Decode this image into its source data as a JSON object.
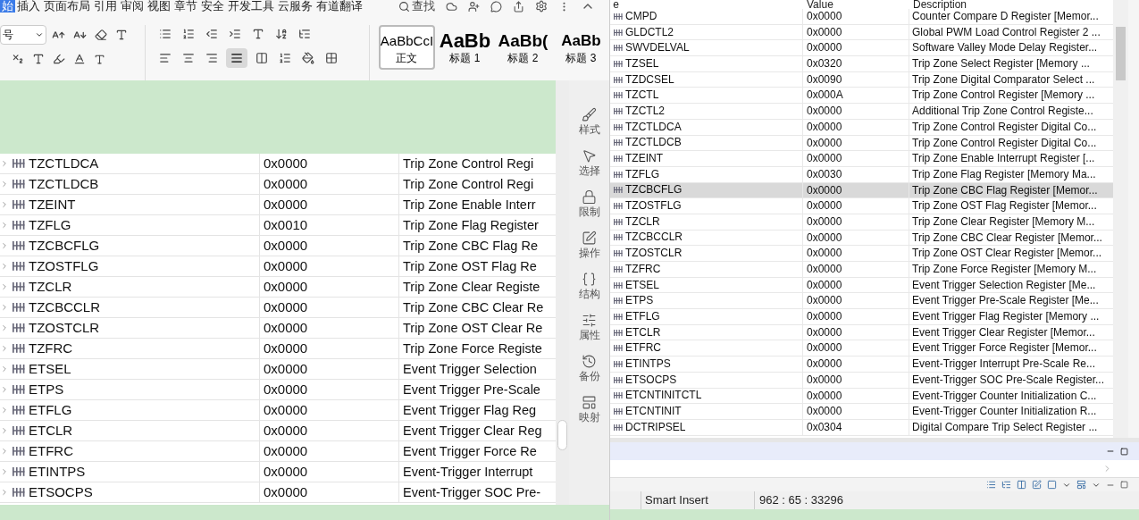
{
  "document_toolbar": {
    "menu_tabs": [
      {
        "label": "始",
        "selected": true
      },
      {
        "label": "插入",
        "selected": false
      },
      {
        "label": "页面布局",
        "selected": false
      },
      {
        "label": "引用",
        "selected": false
      },
      {
        "label": "审阅",
        "selected": false
      },
      {
        "label": "视图",
        "selected": false
      },
      {
        "label": "章节",
        "selected": false
      },
      {
        "label": "安全",
        "selected": false
      },
      {
        "label": "开发工具",
        "selected": false
      },
      {
        "label": "云服务",
        "selected": false
      },
      {
        "label": "有道翻译",
        "selected": false
      }
    ],
    "search": "查找",
    "font_size": "号",
    "styles": [
      {
        "kind": "body",
        "preview": "AaBbCcI",
        "label": "正文",
        "selected": true
      },
      {
        "kind": "heading1",
        "preview": "AaBb",
        "label": "标题 1",
        "selected": false
      },
      {
        "kind": "heading2",
        "preview": "AaBb(",
        "label": "标题 2",
        "selected": false
      },
      {
        "kind": "heading3",
        "preview": "AaBb",
        "label": "标题 3",
        "selected": false
      }
    ]
  },
  "document_table": {
    "rows": [
      {
        "name": "TZCTLDCA",
        "value": "0x0000",
        "description": "Trip Zone Control Regi"
      },
      {
        "name": "TZCTLDCB",
        "value": "0x0000",
        "description": "Trip Zone Control Regi"
      },
      {
        "name": "TZEINT",
        "value": "0x0000",
        "description": "Trip Zone Enable Interr"
      },
      {
        "name": "TZFLG",
        "value": "0x0010",
        "description": "Trip Zone Flag Register"
      },
      {
        "name": "TZCBCFLG",
        "value": "0x0000",
        "description": "Trip Zone CBC Flag Re"
      },
      {
        "name": "TZOSTFLG",
        "value": "0x0000",
        "description": "Trip Zone OST Flag Re"
      },
      {
        "name": "TZCLR",
        "value": "0x0000",
        "description": "Trip Zone Clear Registe"
      },
      {
        "name": "TZCBCCLR",
        "value": "0x0000",
        "description": "Trip Zone CBC Clear Re"
      },
      {
        "name": "TZOSTCLR",
        "value": "0x0000",
        "description": "Trip Zone OST Clear Re"
      },
      {
        "name": "TZFRC",
        "value": "0x0000",
        "description": "Trip Zone Force Registe"
      },
      {
        "name": "ETSEL",
        "value": "0x0000",
        "description": "Event Trigger Selection"
      },
      {
        "name": "ETPS",
        "value": "0x0000",
        "description": "Event Trigger Pre-Scale"
      },
      {
        "name": "ETFLG",
        "value": "0x0000",
        "description": "Event Trigger Flag Reg"
      },
      {
        "name": "ETCLR",
        "value": "0x0000",
        "description": "Event Trigger Clear Reg"
      },
      {
        "name": "ETFRC",
        "value": "0x0000",
        "description": "Event Trigger Force Re"
      },
      {
        "name": "ETINTPS",
        "value": "0x0000",
        "description": "Event-Trigger Interrupt"
      },
      {
        "name": "ETSOCPS",
        "value": "0x0000",
        "description": "Event-Trigger SOC Pre-"
      }
    ]
  },
  "side_panel": {
    "items": [
      {
        "kind": "style",
        "label": "样式"
      },
      {
        "kind": "select",
        "label": "选择"
      },
      {
        "kind": "restrict",
        "label": "限制"
      },
      {
        "kind": "operate",
        "label": "操作"
      },
      {
        "kind": "structure",
        "label": "结构"
      },
      {
        "kind": "property",
        "label": "属性"
      },
      {
        "kind": "backup",
        "label": "备份"
      },
      {
        "kind": "mapping",
        "label": "映射"
      }
    ]
  },
  "register_view": {
    "columns": [
      "e",
      "Value",
      "Description"
    ],
    "rows": [
      {
        "name": "CMPD",
        "value": "0x0000",
        "description": "Counter Compare D Register [Memor...",
        "selected": false
      },
      {
        "name": "GLDCTL2",
        "value": "0x0000",
        "description": "Global PWM Load Control Register 2 ...",
        "selected": false
      },
      {
        "name": "SWVDELVAL",
        "value": "0x0000",
        "description": "Software Valley Mode Delay Register...",
        "selected": false
      },
      {
        "name": "TZSEL",
        "value": "0x0320",
        "description": "Trip Zone Select Register  [Memory ...",
        "selected": false
      },
      {
        "name": "TZDCSEL",
        "value": "0x0090",
        "description": "Trip Zone Digital Comparator Select ...",
        "selected": false
      },
      {
        "name": "TZCTL",
        "value": "0x000A",
        "description": "Trip Zone Control Register [Memory ...",
        "selected": false
      },
      {
        "name": "TZCTL2",
        "value": "0x0000",
        "description": "Additional Trip Zone Control Registe...",
        "selected": false
      },
      {
        "name": "TZCTLDCA",
        "value": "0x0000",
        "description": "Trip Zone Control Register Digital Co...",
        "selected": false
      },
      {
        "name": "TZCTLDCB",
        "value": "0x0000",
        "description": "Trip Zone Control Register Digital Co...",
        "selected": false
      },
      {
        "name": "TZEINT",
        "value": "0x0000",
        "description": "Trip Zone Enable Interrupt Register [...",
        "selected": false
      },
      {
        "name": "TZFLG",
        "value": "0x0030",
        "description": "Trip Zone Flag Register [Memory Ma...",
        "selected": false
      },
      {
        "name": "TZCBCFLG",
        "value": "0x0000",
        "description": "Trip Zone CBC Flag Register [Memor...",
        "selected": true
      },
      {
        "name": "TZOSTFLG",
        "value": "0x0000",
        "description": "Trip Zone OST Flag Register [Memor...",
        "selected": false
      },
      {
        "name": "TZCLR",
        "value": "0x0000",
        "description": "Trip Zone Clear Register [Memory M...",
        "selected": false
      },
      {
        "name": "TZCBCCLR",
        "value": "0x0000",
        "description": "Trip Zone CBC Clear Register [Memor...",
        "selected": false
      },
      {
        "name": "TZOSTCLR",
        "value": "0x0000",
        "description": "Trip Zone OST Clear Register [Memor...",
        "selected": false
      },
      {
        "name": "TZFRC",
        "value": "0x0000",
        "description": "Trip Zone Force Register [Memory M...",
        "selected": false
      },
      {
        "name": "ETSEL",
        "value": "0x0000",
        "description": "Event Trigger Selection Register [Me...",
        "selected": false
      },
      {
        "name": "ETPS",
        "value": "0x0000",
        "description": "Event Trigger Pre-Scale Register [Me...",
        "selected": false
      },
      {
        "name": "ETFLG",
        "value": "0x0000",
        "description": "Event Trigger Flag Register [Memory ...",
        "selected": false
      },
      {
        "name": "ETCLR",
        "value": "0x0000",
        "description": "Event Trigger Clear Register [Memor...",
        "selected": false
      },
      {
        "name": "ETFRC",
        "value": "0x0000",
        "description": "Event Trigger Force Register [Memor...",
        "selected": false
      },
      {
        "name": "ETINTPS",
        "value": "0x0000",
        "description": "Event-Trigger Interrupt Pre-Scale Re...",
        "selected": false
      },
      {
        "name": "ETSOCPS",
        "value": "0x0000",
        "description": "Event-Trigger SOC Pre-Scale Register...",
        "selected": false
      },
      {
        "name": "ETCNTINITCTL",
        "value": "0x0000",
        "description": "Event-Trigger Counter Initialization C...",
        "selected": false
      },
      {
        "name": "ETCNTINIT",
        "value": "0x0000",
        "description": "Event-Trigger Counter Initialization R...",
        "selected": false
      },
      {
        "name": "DCTRIPSEL",
        "value": "0x0304",
        "description": "Digital Compare Trip Select Register ...",
        "selected": false
      }
    ]
  },
  "status_bar": {
    "mode": "Smart Insert",
    "position": "962 : 65 : 33296"
  }
}
